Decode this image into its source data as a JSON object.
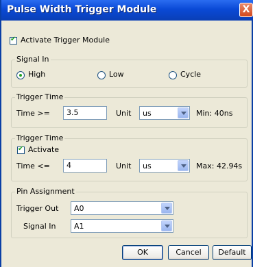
{
  "window": {
    "title": "Pulse Width Trigger Module",
    "close_glyph": "X"
  },
  "activate_module": {
    "label": "Activate Trigger Module",
    "checked": true
  },
  "signal_in_group": {
    "legend": "Signal In",
    "options": [
      {
        "label": "High",
        "selected": true
      },
      {
        "label": "Low",
        "selected": false
      },
      {
        "label": "Cycle",
        "selected": false
      }
    ]
  },
  "trigger_time_1": {
    "legend": "Trigger Time",
    "time_label": "Time >=",
    "time_value": "3.5",
    "unit_label": "Unit",
    "unit_value": "us",
    "limit_text": "Min: 40ns"
  },
  "trigger_time_2": {
    "legend": "Trigger Time",
    "activate_label": "Activate",
    "activate_checked": true,
    "time_label": "Time <=",
    "time_value": "4",
    "unit_label": "Unit",
    "unit_value": "us",
    "limit_text": "Max: 42.94s"
  },
  "pin_assignment": {
    "legend": "Pin Assignment",
    "trigger_out_label": "Trigger Out",
    "trigger_out_value": "A0",
    "signal_in_label": "Signal In",
    "signal_in_value": "A1"
  },
  "buttons": {
    "ok": "OK",
    "cancel": "Cancel",
    "default": "Default"
  }
}
